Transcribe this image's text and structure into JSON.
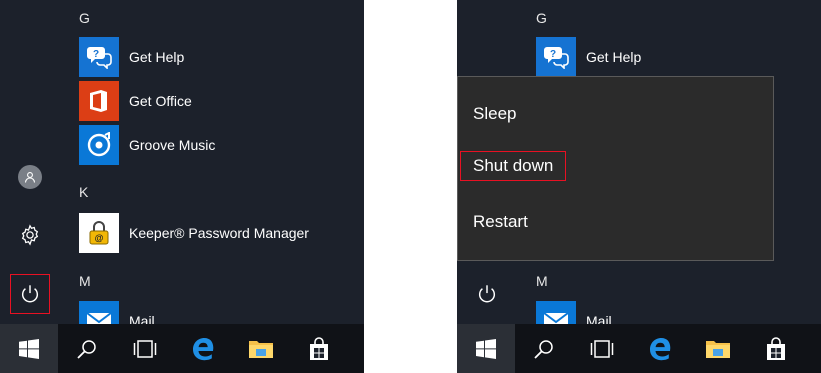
{
  "left": {
    "groups": [
      {
        "letter": "G",
        "apps": [
          {
            "label": "Get Help",
            "icon": "get-help-icon",
            "tile_color": "#1573d2"
          },
          {
            "label": "Get Office",
            "icon": "office-icon",
            "tile_color": "#dc3e15"
          },
          {
            "label": "Groove Music",
            "icon": "groove-music-icon",
            "tile_color": "#0a78d7"
          }
        ]
      },
      {
        "letter": "K",
        "apps": [
          {
            "label": "Keeper® Password Manager",
            "icon": "keeper-lock-icon",
            "tile_color": "#ffffff"
          }
        ]
      },
      {
        "letter": "M",
        "apps": [
          {
            "label": "Mail",
            "icon": "mail-icon",
            "tile_color": "#0a78d7"
          }
        ]
      }
    ],
    "rail": [
      "user-avatar-icon",
      "settings-gear-icon",
      "power-icon"
    ],
    "highlighted": "power-button"
  },
  "right": {
    "groups": [
      {
        "letter": "G",
        "apps": [
          {
            "label": "Get Help",
            "icon": "get-help-icon",
            "tile_color": "#1573d2"
          }
        ]
      },
      {
        "letter": "M",
        "apps": [
          {
            "label": "Mail",
            "icon": "mail-icon",
            "tile_color": "#0a78d7"
          }
        ]
      }
    ],
    "power_menu": {
      "sleep": "Sleep",
      "shut_down": "Shut down",
      "restart": "Restart"
    },
    "highlighted": "shut-down"
  },
  "taskbar": [
    "windows-start-icon",
    "search-icon",
    "task-view-icon",
    "edge-icon",
    "file-explorer-icon",
    "store-icon"
  ],
  "colors": {
    "start_bg": "#1c212b",
    "taskbar_bg": "#101217",
    "highlight": "#e81123",
    "menu_bg": "#2b2b2b"
  }
}
